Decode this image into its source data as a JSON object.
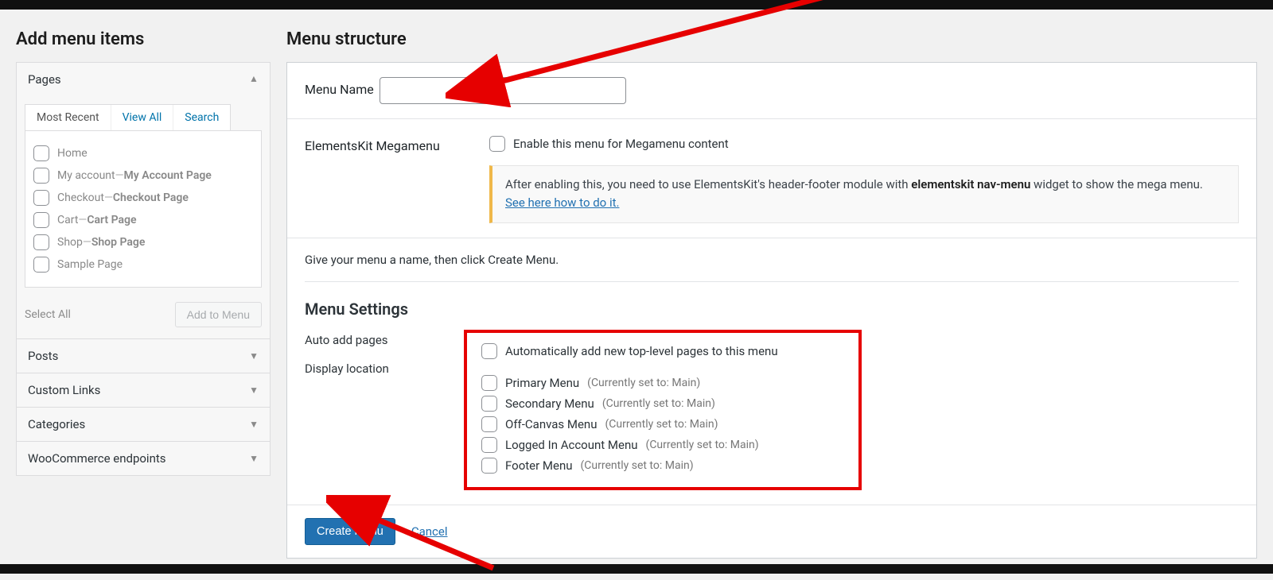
{
  "sidebar": {
    "heading": "Add menu items",
    "pages": {
      "title": "Pages",
      "tabs": {
        "recent": "Most Recent",
        "viewall": "View All",
        "search": "Search"
      },
      "items": [
        {
          "label": "Home",
          "suffix": ""
        },
        {
          "label": "My account",
          "suffix": " — ",
          "page": "My Account Page"
        },
        {
          "label": "Checkout",
          "suffix": " — ",
          "page": "Checkout Page"
        },
        {
          "label": "Cart",
          "suffix": " — ",
          "page": "Cart Page"
        },
        {
          "label": "Shop",
          "suffix": " — ",
          "page": "Shop Page"
        },
        {
          "label": "Sample Page",
          "suffix": ""
        }
      ],
      "select_all": "Select All",
      "add_btn": "Add to Menu"
    },
    "accordions": {
      "posts": "Posts",
      "custom_links": "Custom Links",
      "categories": "Categories",
      "woo": "WooCommerce endpoints"
    }
  },
  "main": {
    "heading": "Menu structure",
    "menu_name_label": "Menu Name",
    "megamenu": {
      "title": "ElementsKit Megamenu",
      "enable_label": "Enable this menu for Megamenu content",
      "note_pre": "After enabling this, you need to use ElementsKit's header-footer module with ",
      "note_strong": "elementskit nav-menu",
      "note_post": " widget to show the mega menu. ",
      "note_link": "See here how to do it."
    },
    "instruction": "Give your menu a name, then click Create Menu.",
    "settings": {
      "heading": "Menu Settings",
      "auto_add_label": "Auto add pages",
      "auto_add_desc": "Automatically add new top-level pages to this menu",
      "display_location_label": "Display location",
      "locations": [
        {
          "name": "Primary Menu",
          "current": "(Currently set to: Main)"
        },
        {
          "name": "Secondary Menu",
          "current": "(Currently set to: Main)"
        },
        {
          "name": "Off-Canvas Menu",
          "current": "(Currently set to: Main)"
        },
        {
          "name": "Logged In Account Menu",
          "current": "(Currently set to: Main)"
        },
        {
          "name": "Footer Menu",
          "current": "(Currently set to: Main)"
        }
      ]
    },
    "create_btn": "Create Menu",
    "cancel_link": "Cancel"
  }
}
